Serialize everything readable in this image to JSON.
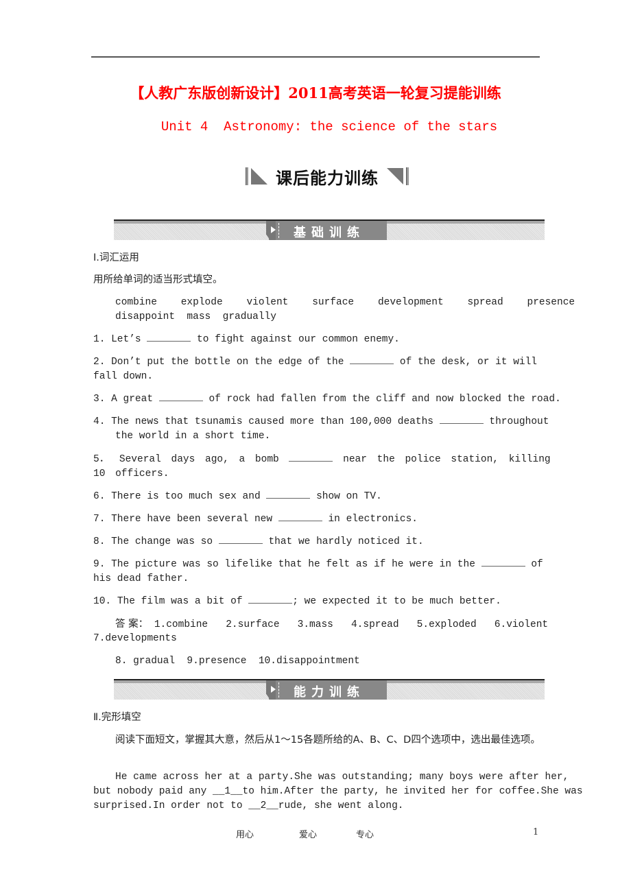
{
  "header": {
    "title_cn": "【人教广东版创新设计】2011高考英语一轮复习提能训练",
    "title_en": "Unit 4  Astronomy: the science of the stars",
    "subtitle": "课后能力训练"
  },
  "sections": [
    {
      "banner": "基础训练",
      "heading": "Ⅰ.词汇运用",
      "instruction": "用所给单词的适当形式填空。",
      "word_bank": [
        "combine",
        "explode",
        "violent",
        "surface",
        "development",
        "spread",
        "presence",
        "disappoint",
        "mass",
        "gradually"
      ],
      "questions": [
        {
          "num": "1.",
          "before": "Let’s",
          "after": "to fight against our common enemy."
        },
        {
          "num": "2.",
          "before": "Don’t put the bottle on the edge of the",
          "after": "of the desk, or it will fall down."
        },
        {
          "num": "3.",
          "before": "A great",
          "after": "of rock had fallen from the cliff and now blocked the road."
        },
        {
          "num": "4.",
          "before": "The news that tsunamis caused more than 100,000 deaths",
          "after": "throughout the world in a short time."
        },
        {
          "num": "5．",
          "before": "Several days ago, a bomb",
          "after": "near the police station, killing 10 officers."
        },
        {
          "num": "6.",
          "before": "There is too much sex and",
          "after": "show on TV."
        },
        {
          "num": "7.",
          "before": "There have been several new",
          "after": "in electronics."
        },
        {
          "num": "8.",
          "before": "The change was so",
          "after": "that we hardly noticed it."
        },
        {
          "num": "9.",
          "before": "The picture was so lifelike that he felt as if he were in the",
          "after": "of his dead father."
        },
        {
          "num": "10.",
          "before": "The film was a bit of",
          "after": "; we expected it to be much better."
        }
      ],
      "answer_label": "答 案：",
      "answers_line1": "1.combine   2.surface   3.mass   4.spread   5.exploded   6.violent",
      "answers_line2": "7.developments",
      "answers_line3": "8. gradual  9.presence  10.disappointment"
    },
    {
      "banner": "能力训练",
      "heading": "Ⅱ.完形填空",
      "instruction": "阅读下面短文，掌握其大意，然后从1～15各题所给的A、B、C、D四个选项中，选出最佳选项。",
      "passage": [
        "He came across her at a party.She was outstanding; many boys were after her,",
        "but nobody paid any __1__to him.After the party, he invited her for coffee.She was",
        "surprised.In order not to __2__rude, she went along."
      ]
    }
  ],
  "footer": {
    "items": [
      "用心",
      "爱心",
      "专心"
    ],
    "page_number": "1"
  }
}
